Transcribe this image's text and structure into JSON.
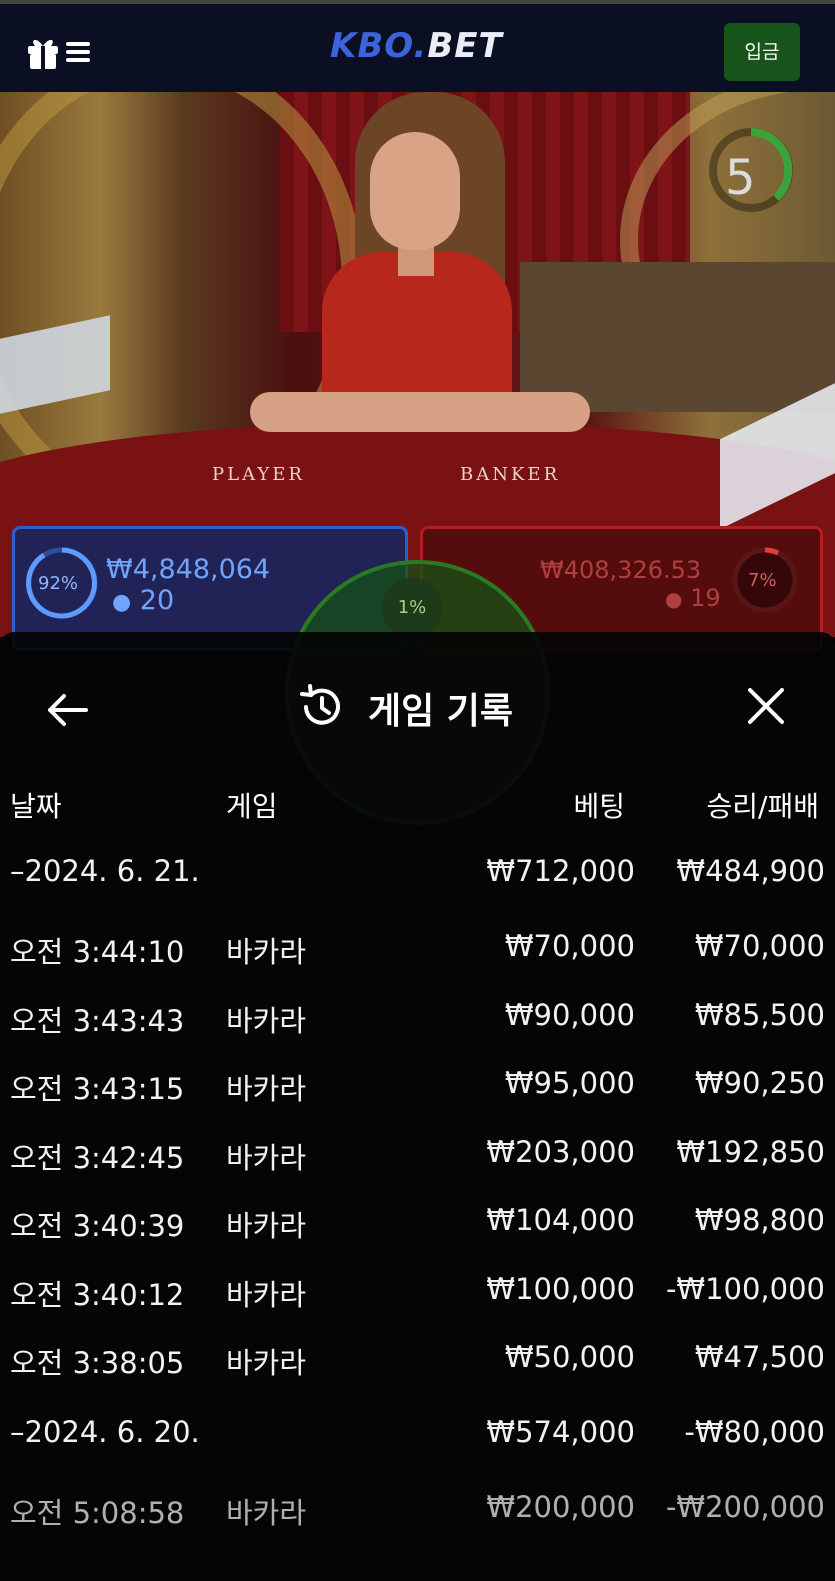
{
  "header": {
    "brand_main": "KBO.",
    "brand_sub": "BET",
    "deposit_label": "입금",
    "icons": {
      "gift": "gift-icon",
      "menu": "menu-icon"
    }
  },
  "scene": {
    "timer": "5",
    "table_player": "PLAYER",
    "table_banker": "BANKER"
  },
  "bets": {
    "player": {
      "pct": "92%",
      "amount": "₩4,848,064",
      "count": "20"
    },
    "banker": {
      "pct": "7%",
      "amount": "₩408,326.53",
      "count": "19"
    },
    "tie": {
      "pct": "1%"
    }
  },
  "modal": {
    "title": "게임 기록",
    "columns": {
      "date": "날짜",
      "game": "게임",
      "bet": "베팅",
      "winloss": "승리/패배"
    },
    "rows": [
      {
        "date": "–2024. 6. 21.",
        "game": "",
        "bet": "₩712,000",
        "wl": "₩484,900"
      },
      {
        "date": "오전 3:44:10",
        "game": "바카라",
        "bet": "₩70,000",
        "wl": "₩70,000"
      },
      {
        "date": "오전 3:43:43",
        "game": "바카라",
        "bet": "₩90,000",
        "wl": "₩85,500"
      },
      {
        "date": "오전 3:43:15",
        "game": "바카라",
        "bet": "₩95,000",
        "wl": "₩90,250"
      },
      {
        "date": "오전 3:42:45",
        "game": "바카라",
        "bet": "₩203,000",
        "wl": "₩192,850"
      },
      {
        "date": "오전 3:40:39",
        "game": "바카라",
        "bet": "₩104,000",
        "wl": "₩98,800"
      },
      {
        "date": "오전 3:40:12",
        "game": "바카라",
        "bet": "₩100,000",
        "wl": "-₩100,000"
      },
      {
        "date": "오전 3:38:05",
        "game": "바카라",
        "bet": "₩50,000",
        "wl": "₩47,500"
      },
      {
        "date": "–2024. 6. 20.",
        "game": "",
        "bet": "₩574,000",
        "wl": "-₩80,000"
      },
      {
        "date": "오전 5:08:58",
        "game": "바카라",
        "bet": "₩200,000",
        "wl": "-₩200,000"
      }
    ]
  }
}
